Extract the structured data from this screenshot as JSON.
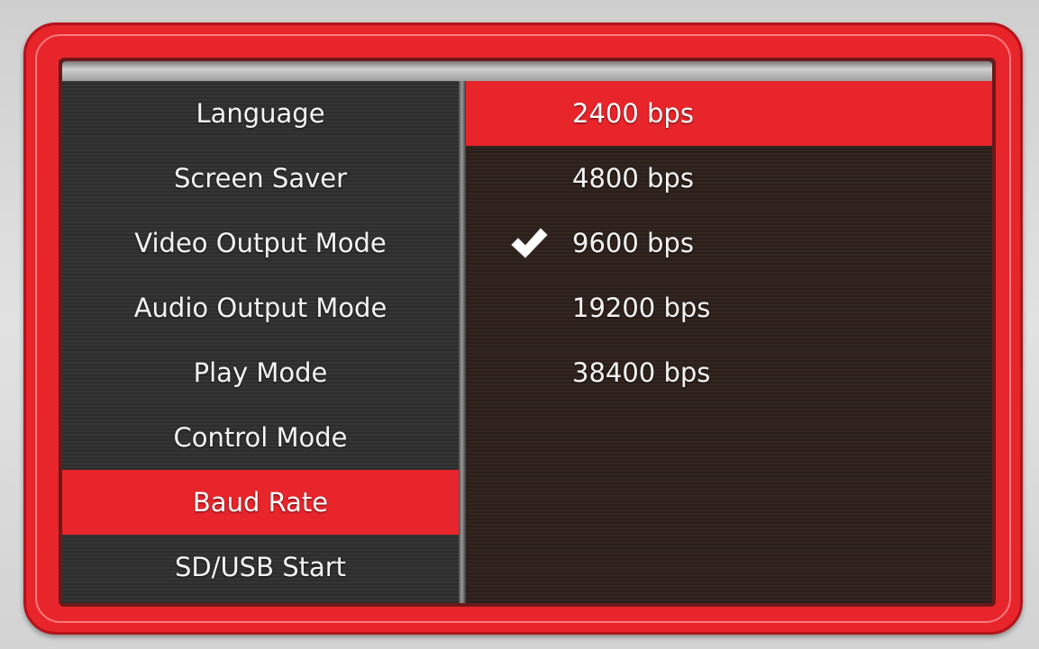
{
  "settings_menu": {
    "items": [
      {
        "label": "Language"
      },
      {
        "label": "Screen Saver"
      },
      {
        "label": "Video Output Mode"
      },
      {
        "label": "Audio Output Mode"
      },
      {
        "label": "Play Mode"
      },
      {
        "label": "Control Mode"
      },
      {
        "label": "Baud Rate",
        "selected": true
      },
      {
        "label": "SD/USB Start"
      }
    ]
  },
  "baud_options": {
    "items": [
      {
        "label": "2400 bps",
        "highlighted": true
      },
      {
        "label": "4800 bps"
      },
      {
        "label": "9600 bps",
        "checked": true
      },
      {
        "label": "19200 bps"
      },
      {
        "label": "38400 bps"
      }
    ]
  },
  "colors": {
    "accent": "#e8252b",
    "frame_dark": "#b3141a",
    "text": "#f4f4f4"
  },
  "icons": {
    "checked": "check-icon"
  }
}
